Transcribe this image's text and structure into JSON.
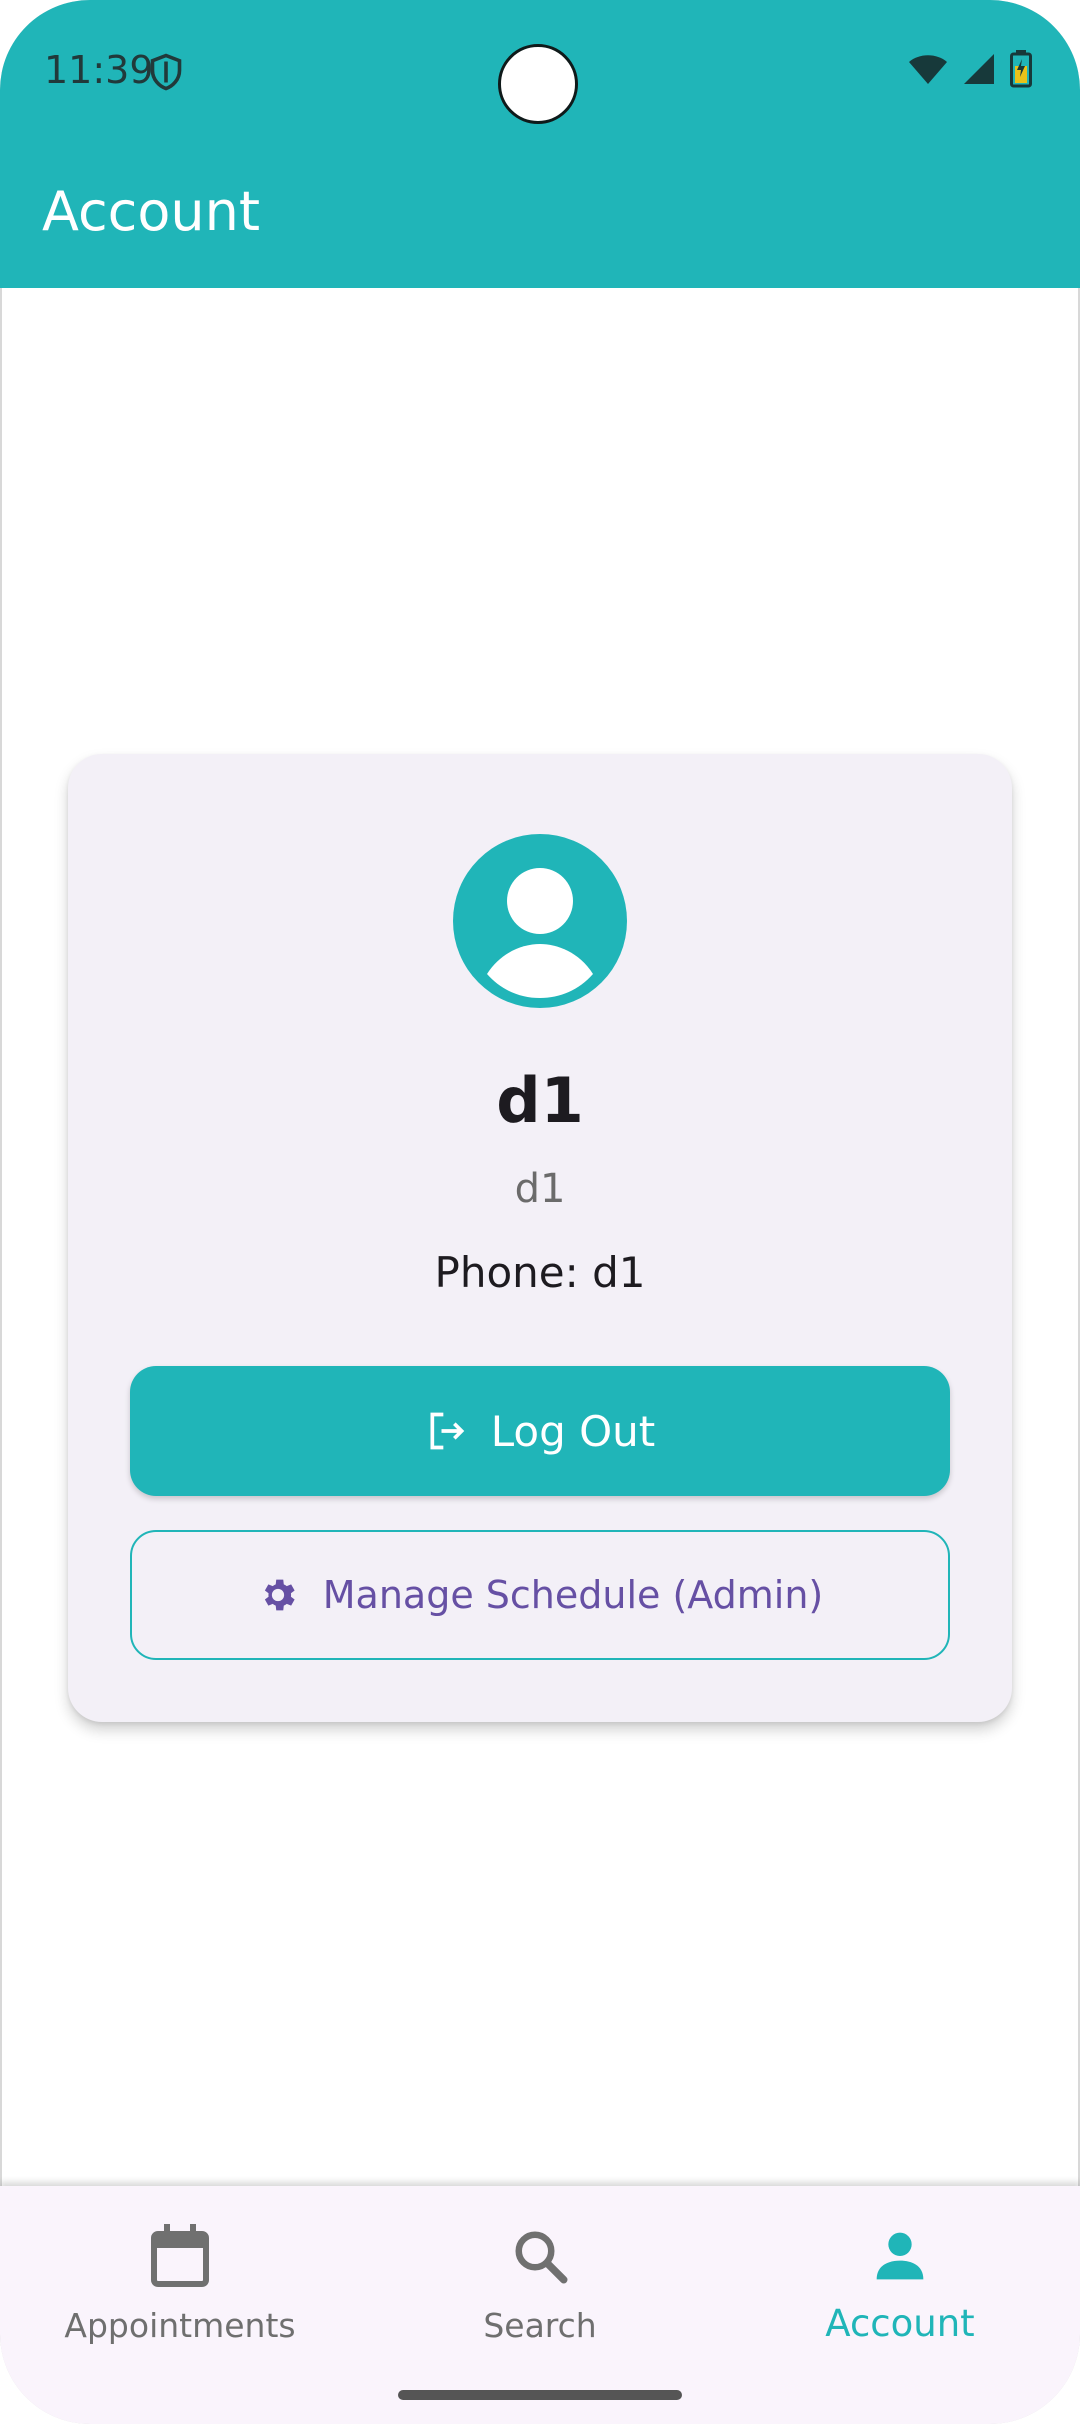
{
  "status_bar": {
    "time": "11:39",
    "icons": [
      "shield-icon",
      "wifi-icon",
      "signal-icon",
      "battery-icon"
    ]
  },
  "app_bar": {
    "title": "Account"
  },
  "profile": {
    "avatar_icon": "account-circle-icon",
    "name": "d1",
    "username": "d1",
    "phone": "Phone: d1"
  },
  "actions": {
    "logout_label": "Log Out",
    "logout_icon": "logout-icon",
    "admin_label": "Manage Schedule (Admin)",
    "admin_icon": "gear-icon"
  },
  "bottom_nav": {
    "items": [
      {
        "label": "Appointments",
        "icon": "calendar-icon",
        "active": false
      },
      {
        "label": "Search",
        "icon": "search-icon",
        "active": false
      },
      {
        "label": "Account",
        "icon": "person-icon",
        "active": true
      }
    ]
  },
  "colors": {
    "primary": "#20b5b8",
    "card_bg": "#f3f0f7",
    "admin_text": "#6650a4",
    "nav_bg": "#faf4fc"
  }
}
